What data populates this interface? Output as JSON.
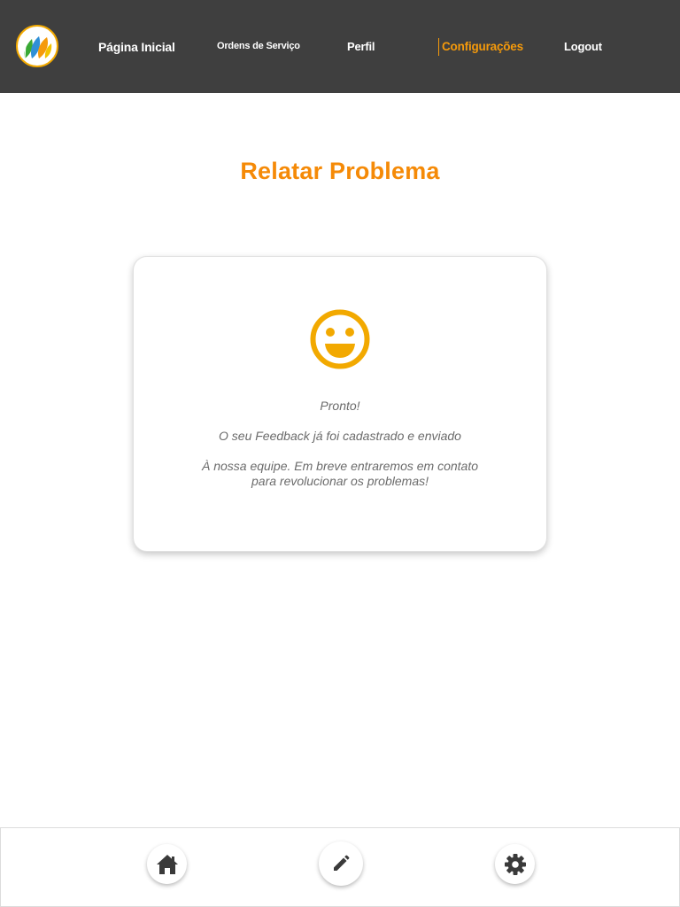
{
  "colors": {
    "topbar_bg": "#3f3f3f",
    "accent": "#f58a07",
    "smiley": "#f2a900",
    "nav_active": "#f59a0b",
    "text_muted": "#6b6b6b",
    "icon_dark": "#3a3a3a"
  },
  "header": {
    "logo_icon": "company-leaves-logo",
    "nav": {
      "home": "Página Inicial",
      "orders": "Ordens de Serviço",
      "profile": "Perfil",
      "settings": "Configurações",
      "logout": "Logout"
    },
    "active_item": "settings"
  },
  "main": {
    "title": "Relatar Problema",
    "card": {
      "icon": "smiley-face-icon",
      "line1": "Pronto!",
      "line2": "O seu Feedback já foi cadastrado e enviado",
      "line3a": "À nossa equipe. Em breve entraremos em contato",
      "line3b": "para revolucionar os problemas!"
    }
  },
  "footer": {
    "buttons": [
      {
        "icon": "home-icon"
      },
      {
        "icon": "pencil-icon"
      },
      {
        "icon": "gear-icon"
      }
    ]
  }
}
